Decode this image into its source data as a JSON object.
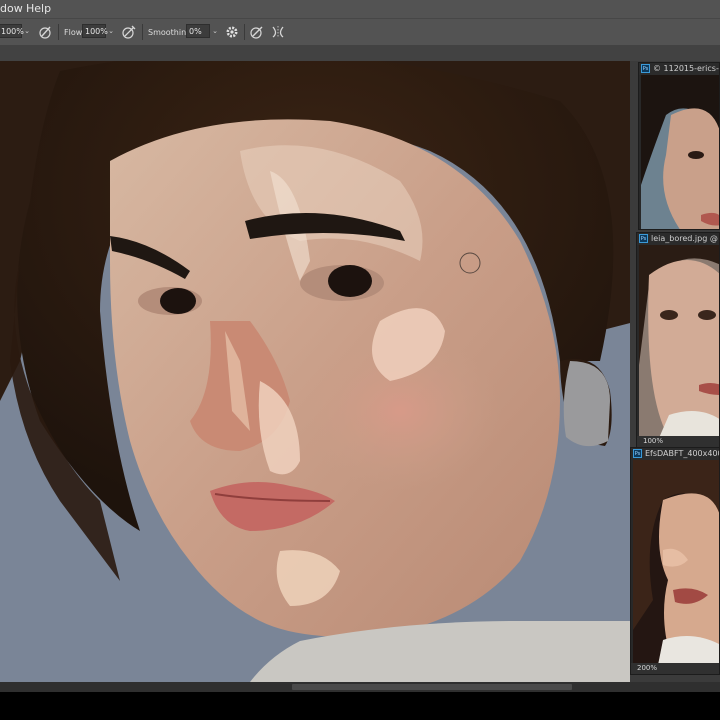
{
  "menu": {
    "items": [
      "dow",
      "Help"
    ]
  },
  "options": {
    "opacity_value": "100%",
    "flow_label": "Flow:",
    "flow_value": "100%",
    "smoothing_label": "Smoothing:",
    "smoothing_value": "0%"
  },
  "refs": [
    {
      "title": "© 112015-erics-wor",
      "zoom": ""
    },
    {
      "title": "leia_bored.jpg @ 1...",
      "zoom": "100%"
    },
    {
      "title": "EfsDABFT_400x400.jpg",
      "zoom": "200%"
    }
  ],
  "colors": {
    "canvas_bg": "#7a8597",
    "chrome": "#535353",
    "accent": "#3a9ad9"
  },
  "icons": [
    "airbrush-icon",
    "pressure-opacity-icon",
    "gear-icon",
    "pressure-size-icon",
    "symmetry-icon",
    "brush-cursor-icon"
  ]
}
